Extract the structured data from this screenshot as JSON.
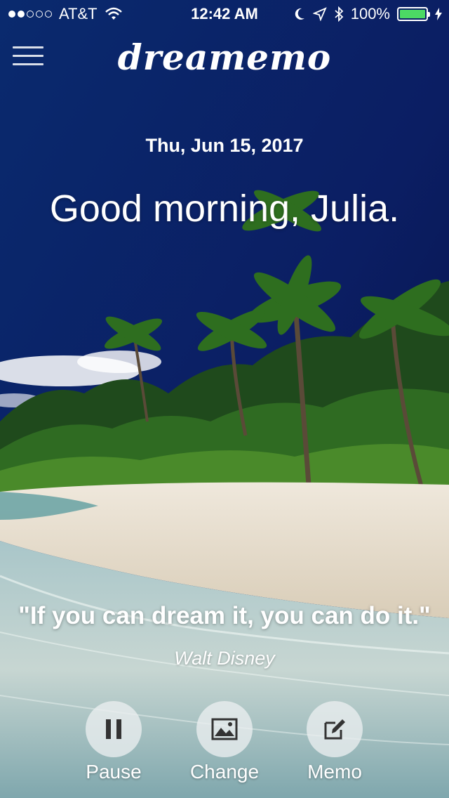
{
  "status_bar": {
    "carrier": "AT&T",
    "signal_strength": 2,
    "time": "12:42 AM",
    "battery_percent": "100%",
    "icons": [
      "wifi-icon",
      "moon-icon",
      "location-icon",
      "bluetooth-icon",
      "battery-icon",
      "charging-bolt-icon"
    ]
  },
  "nav": {
    "menu_icon": "hamburger-menu-icon",
    "logo_text": "dreamemo"
  },
  "main": {
    "date": "Thu, Jun 15, 2017",
    "greeting": "Good morning, Julia.",
    "quote": "\"If you can dream it, you can do it.\"",
    "author": "Walt Disney"
  },
  "actions": [
    {
      "label": "Pause",
      "icon": "pause-icon"
    },
    {
      "label": "Change",
      "icon": "image-icon"
    },
    {
      "label": "Memo",
      "icon": "edit-icon"
    }
  ],
  "colors": {
    "battery_fill": "#4cd964",
    "button_bg": "#ebeef0",
    "icon_dark": "#333333"
  }
}
